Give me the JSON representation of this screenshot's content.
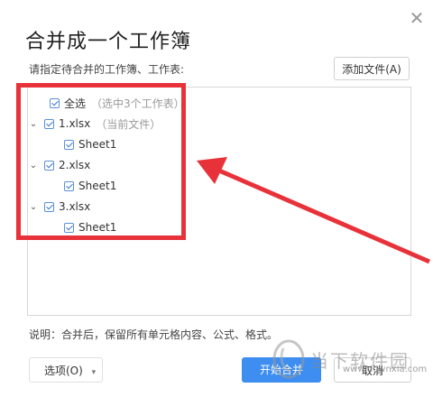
{
  "dialog": {
    "title": "合并成一个工作簿",
    "close_icon": "close-icon",
    "prompt": "请指定待合并的工作簿、工作表:",
    "add_file_label": "添加文件(A)",
    "note": "说明：合并后，保留所有单元格内容、公式、格式。",
    "options_label": "选项(O)",
    "ok_label": "开始合并",
    "cancel_label": "取消"
  },
  "tree": {
    "select_all_label": "全选",
    "select_all_hint": "（选中3个工作表）",
    "files": [
      {
        "name": "1.xlsx",
        "hint": "（当前文件）",
        "sheets": [
          "Sheet1"
        ]
      },
      {
        "name": "2.xlsx",
        "hint": "",
        "sheets": [
          "Sheet1"
        ]
      },
      {
        "name": "3.xlsx",
        "hint": "",
        "sheets": [
          "Sheet1"
        ]
      }
    ]
  },
  "watermark": {
    "text": "当下软件园",
    "url": "www.downxia.com"
  },
  "colors": {
    "primary": "#3d8ef0",
    "annotation_red": "#e8323a",
    "checkbox": "#3b78d6"
  }
}
